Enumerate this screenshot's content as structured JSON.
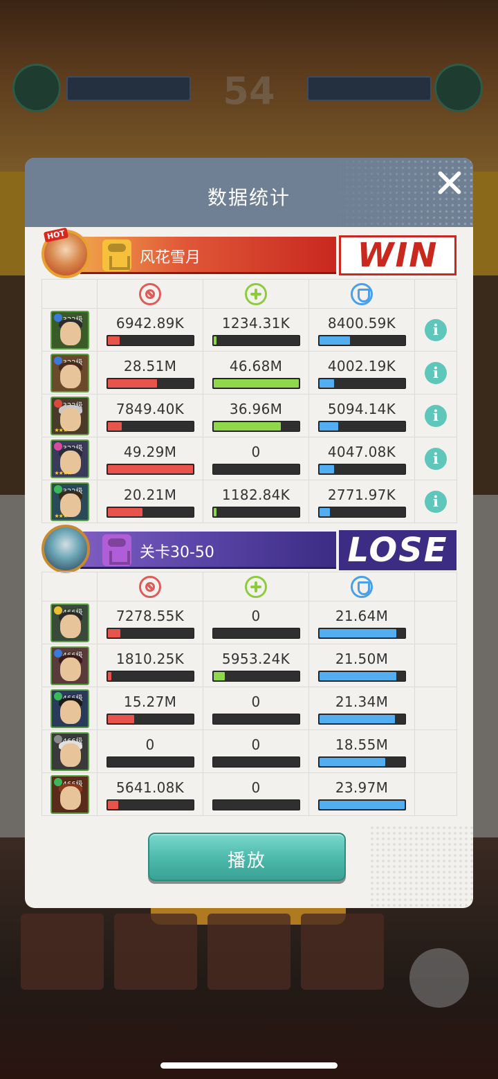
{
  "background": {
    "score": "54"
  },
  "modal": {
    "title": "数据统计",
    "play_label": "播放"
  },
  "teams": [
    {
      "name": "风花雪月",
      "result": "WIN",
      "avatar_badge": "HOT",
      "heroes": [
        {
          "level": "322级",
          "damage": "6942.89K",
          "damage_frac": 0.14,
          "heal": "1234.31K",
          "heal_frac": 0.03,
          "shield": "8400.59K",
          "shield_frac": 0.36
        },
        {
          "level": "322级",
          "damage": "28.51M",
          "damage_frac": 0.58,
          "heal": "46.68M",
          "heal_frac": 1.0,
          "shield": "4002.19K",
          "shield_frac": 0.17
        },
        {
          "level": "322级",
          "damage": "7849.40K",
          "damage_frac": 0.16,
          "heal": "36.96M",
          "heal_frac": 0.79,
          "shield": "5094.14K",
          "shield_frac": 0.22
        },
        {
          "level": "322级",
          "damage": "49.29M",
          "damage_frac": 1.0,
          "heal": "0",
          "heal_frac": 0,
          "shield": "4047.08K",
          "shield_frac": 0.17
        },
        {
          "level": "322级",
          "damage": "20.21M",
          "damage_frac": 0.41,
          "heal": "1182.84K",
          "heal_frac": 0.03,
          "shield": "2771.97K",
          "shield_frac": 0.12
        }
      ]
    },
    {
      "name": "关卡30-50",
      "result": "LOSE",
      "heroes": [
        {
          "level": "466级",
          "damage": "7278.55K",
          "damage_frac": 0.15,
          "heal": "0",
          "heal_frac": 0,
          "shield": "21.64M",
          "shield_frac": 0.9
        },
        {
          "level": "466级",
          "damage": "1810.25K",
          "damage_frac": 0.04,
          "heal": "5953.24K",
          "heal_frac": 0.13,
          "shield": "21.50M",
          "shield_frac": 0.9
        },
        {
          "level": "466级",
          "damage": "15.27M",
          "damage_frac": 0.31,
          "heal": "0",
          "heal_frac": 0,
          "shield": "21.34M",
          "shield_frac": 0.89
        },
        {
          "level": "466级",
          "damage": "0",
          "damage_frac": 0,
          "heal": "0",
          "heal_frac": 0,
          "shield": "18.55M",
          "shield_frac": 0.77
        },
        {
          "level": "466级",
          "damage": "5641.08K",
          "damage_frac": 0.12,
          "heal": "0",
          "heal_frac": 0,
          "shield": "23.97M",
          "shield_frac": 1.0
        }
      ]
    }
  ],
  "icons": {
    "damage": "damage-icon",
    "heal": "heal-icon",
    "shield": "shield-icon",
    "info": "info-icon",
    "close": "close-icon"
  },
  "colors": {
    "damage": "#e8534c",
    "heal": "#8fd84a",
    "shield": "#52aef0",
    "win": "#c8281e",
    "lose": "#3c2c84",
    "accent": "#5ec6ba"
  }
}
